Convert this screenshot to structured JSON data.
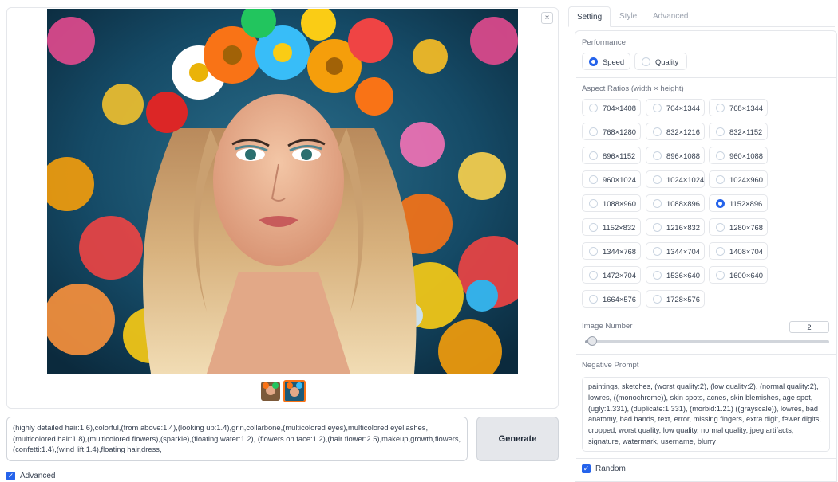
{
  "image_panel": {
    "close_label": "×",
    "main_image_alt": "Portrait of a woman with a colorful flower crown",
    "thumbnails": [
      "thumb-1",
      "thumb-2"
    ]
  },
  "prompt": {
    "text": "(highly detailed hair:1.6),colorful,(from above:1.4),(looking up:1.4),grin,collarbone,(multicolored eyes),multicolored eyellashes,(multicolored hair:1.8),(multicolored flowers),(sparkle),(floating water:1.2), (flowers on face:1.2),(hair flower:2.5),makeup,growth,flowers,(confetti:1.4),(wind lift:1.4),floating hair,dress,"
  },
  "generate_label": "Generate",
  "advanced_label": "Advanced",
  "tabs": [
    "Setting",
    "Style",
    "Advanced"
  ],
  "performance": {
    "label": "Performance",
    "options": [
      "Speed",
      "Quality"
    ],
    "selected": "Speed"
  },
  "aspect_ratios": {
    "label": "Aspect Ratios (width × height)",
    "options": [
      "704×1408",
      "704×1344",
      "768×1344",
      "768×1280",
      "832×1216",
      "832×1152",
      "896×1152",
      "896×1088",
      "960×1088",
      "960×1024",
      "1024×1024",
      "1024×960",
      "1088×960",
      "1088×896",
      "1152×896",
      "1152×832",
      "1216×832",
      "1280×768",
      "1344×768",
      "1344×704",
      "1408×704",
      "1472×704",
      "1536×640",
      "1600×640",
      "1664×576",
      "1728×576"
    ],
    "selected": "1152×896"
  },
  "image_number": {
    "label": "Image Number",
    "value": "2",
    "fraction": 0.03
  },
  "negative_prompt": {
    "label": "Negative Prompt",
    "text": "paintings, sketches, (worst quality:2), (low quality:2), (normal quality:2), lowres, ((monochrome)), skin spots, acnes, skin blemishes, age spot, (ugly:1.331), (duplicate:1.331), (morbid:1.21) ((grayscale)), lowres, bad anatomy, bad hands, text, error, missing fingers, extra digit, fewer digits, cropped, worst quality, low quality, normal quality, jpeg artifacts, signature, watermark, username, blurry"
  },
  "random_label": "Random",
  "colors": {
    "accent": "#2563eb",
    "thumb_border": "#f97316"
  }
}
